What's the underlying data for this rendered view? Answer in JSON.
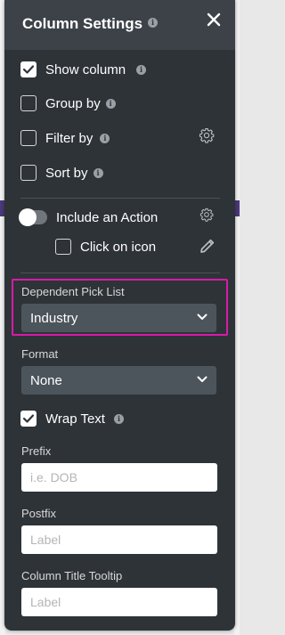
{
  "panel": {
    "title": "Column Settings"
  },
  "options": {
    "show_column": "Show column",
    "group_by": "Group by",
    "filter_by": "Filter by",
    "sort_by": "Sort by",
    "include_action": "Include an Action",
    "click_on_icon": "Click on icon"
  },
  "dependent_pick_list": {
    "label": "Dependent Pick List",
    "value": "Industry"
  },
  "format": {
    "label": "Format",
    "value": "None"
  },
  "wrap_text": "Wrap Text",
  "prefix": {
    "label": "Prefix",
    "placeholder": "i.e. DOB"
  },
  "postfix": {
    "label": "Postfix",
    "placeholder": "Label"
  },
  "column_title_tooltip": {
    "label": "Column Title Tooltip",
    "placeholder": "Label"
  },
  "colors": {
    "panel_bg": "#2e3338",
    "header_bg": "#3c4248",
    "select_bg": "#4d555c",
    "highlight": "#d81ba8"
  }
}
